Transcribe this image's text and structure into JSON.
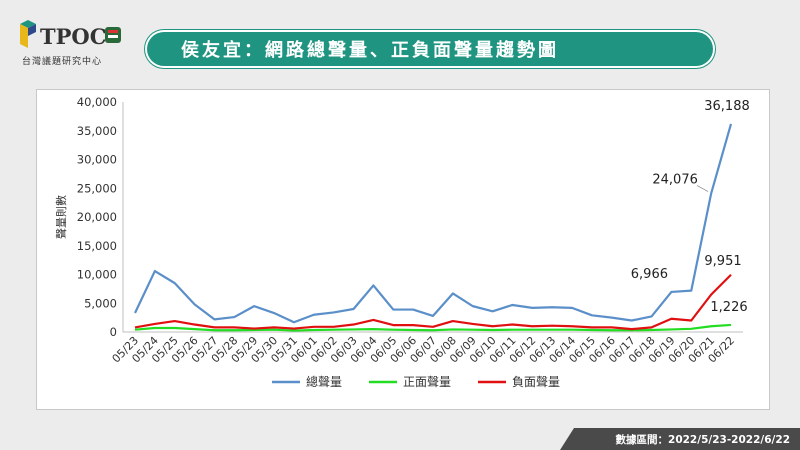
{
  "header": {
    "logo_text": "TPOC",
    "logo_sub": "台灣議題研究中心",
    "title": "侯友宜：網路總聲量、正負面聲量趨勢圖"
  },
  "footer": {
    "range_text": "數據區間：2022/5/23-2022/6/22"
  },
  "chart_data": {
    "type": "line",
    "title": "",
    "xlabel": "",
    "ylabel": "聲量則數",
    "ylim": [
      0,
      40000
    ],
    "yticks": [
      0,
      5000,
      10000,
      15000,
      20000,
      25000,
      30000,
      35000,
      40000
    ],
    "ytick_labels": [
      "0",
      "5,000",
      "10,000",
      "15,000",
      "20,000",
      "25,000",
      "30,000",
      "35,000",
      "40,000"
    ],
    "grid": false,
    "legend_position": "bottom",
    "categories": [
      "05/23",
      "05/24",
      "05/25",
      "05/26",
      "05/27",
      "05/28",
      "05/29",
      "05/30",
      "05/31",
      "06/01",
      "06/02",
      "06/03",
      "06/04",
      "06/05",
      "06/06",
      "06/07",
      "06/08",
      "06/09",
      "06/10",
      "06/11",
      "06/12",
      "06/13",
      "06/14",
      "06/15",
      "06/16",
      "06/17",
      "06/18",
      "06/19",
      "06/20",
      "06/21",
      "06/22"
    ],
    "series": [
      {
        "name": "總聲量",
        "color": "#5b8fc9",
        "values": [
          3300,
          10600,
          8500,
          4800,
          2200,
          2600,
          4500,
          3300,
          1700,
          3000,
          3400,
          4000,
          8100,
          3900,
          3900,
          2800,
          6700,
          4500,
          3600,
          4700,
          4200,
          4300,
          4200,
          2900,
          2500,
          2000,
          2700,
          6966,
          7200,
          24076,
          36188
        ]
      },
      {
        "name": "正面聲量",
        "color": "#22dd22",
        "values": [
          400,
          700,
          700,
          500,
          300,
          300,
          350,
          400,
          250,
          350,
          400,
          450,
          500,
          400,
          350,
          300,
          450,
          400,
          350,
          400,
          400,
          400,
          400,
          350,
          300,
          300,
          350,
          450,
          550,
          1000,
          1226
        ]
      },
      {
        "name": "負面聲量",
        "color": "#e01010",
        "values": [
          800,
          1400,
          1900,
          1300,
          800,
          800,
          600,
          800,
          600,
          900,
          900,
          1300,
          2100,
          1200,
          1200,
          900,
          1900,
          1400,
          1000,
          1300,
          1000,
          1100,
          1000,
          800,
          800,
          500,
          800,
          2300,
          2000,
          6500,
          9951
        ]
      }
    ],
    "annotations": [
      {
        "label": "36,188",
        "series": 0,
        "index": 30
      },
      {
        "label": "24,076",
        "series": 0,
        "index": 29
      },
      {
        "label": "6,966",
        "series": 0,
        "index": 27
      },
      {
        "label": "9,951",
        "series": 2,
        "index": 30
      },
      {
        "label": "1,226",
        "series": 1,
        "index": 30
      }
    ]
  }
}
